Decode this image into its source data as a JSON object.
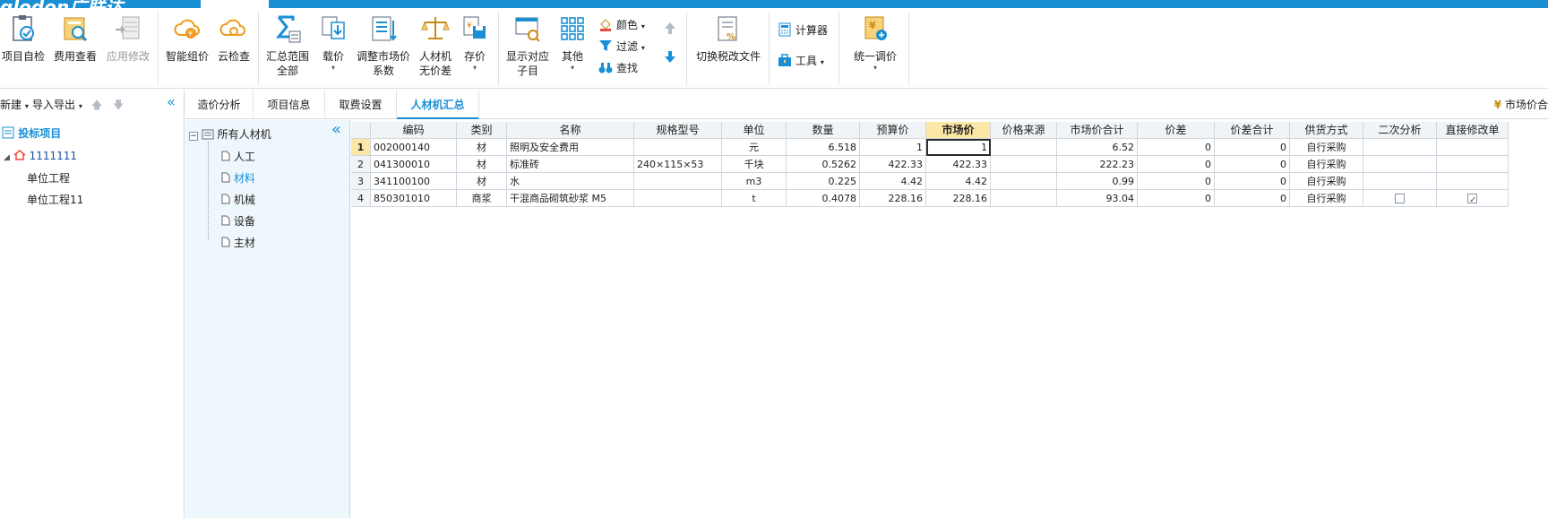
{
  "title_tabs": [
    "",
    ""
  ],
  "ribbon": {
    "items": [
      {
        "label1": "项目自检",
        "label2": ""
      },
      {
        "label1": "费用查看",
        "label2": ""
      },
      {
        "label1": "应用修改",
        "label2": ""
      },
      {
        "label1": "智能组价",
        "label2": ""
      },
      {
        "label1": "云检查",
        "label2": ""
      },
      {
        "label1": "汇总范围",
        "label2": "全部"
      },
      {
        "label1": "载价",
        "label2": ""
      },
      {
        "label1": "调整市场价",
        "label2": "系数"
      },
      {
        "label1": "人材机",
        "label2": "无价差"
      },
      {
        "label1": "存价",
        "label2": ""
      },
      {
        "label1": "显示对应",
        "label2": "子目"
      },
      {
        "label1": "其他",
        "label2": ""
      },
      {
        "label1": "切换税改文件",
        "label2": ""
      },
      {
        "label1": "统一调价",
        "label2": ""
      }
    ],
    "small": {
      "color": "颜色",
      "filter": "过滤",
      "find": "查找",
      "calculator": "计算器",
      "tools": "工具"
    }
  },
  "left_panel": {
    "new": "新建",
    "import_export": "导入导出",
    "root": "投标项目",
    "project": "1111111",
    "units": [
      "单位工程",
      "单位工程11"
    ]
  },
  "tabs": [
    "造价分析",
    "项目信息",
    "取费设置",
    "人材机汇总"
  ],
  "active_tab": "人材机汇总",
  "right_label": "市场价合",
  "category_tree": {
    "root": "所有人材机",
    "items": [
      "人工",
      "材料",
      "机械",
      "设备",
      "主材"
    ],
    "selected": "材料"
  },
  "grid": {
    "columns": [
      "编码",
      "类别",
      "名称",
      "规格型号",
      "单位",
      "数量",
      "预算价",
      "市场价",
      "价格来源",
      "市场价合计",
      "价差",
      "价差合计",
      "供货方式",
      "二次分析",
      "直接修改单"
    ],
    "active_column": "市场价",
    "rows": [
      {
        "n": "1",
        "code": "002000140",
        "type": "材",
        "name": "照明及安全费用",
        "spec": "",
        "unit": "元",
        "qty": "6.518",
        "budget": "1",
        "market": "1",
        "source": "",
        "total": "6.52",
        "diff": "0",
        "diff_total": "0",
        "supply": "自行采购",
        "second": null,
        "direct": null
      },
      {
        "n": "2",
        "code": "041300010",
        "type": "材",
        "name": "标准砖",
        "spec": "240×115×53",
        "unit": "千块",
        "qty": "0.5262",
        "budget": "422.33",
        "market": "422.33",
        "source": "",
        "total": "222.23",
        "diff": "0",
        "diff_total": "0",
        "supply": "自行采购",
        "second": null,
        "direct": null
      },
      {
        "n": "3",
        "code": "341100100",
        "type": "材",
        "name": "水",
        "spec": "",
        "unit": "m3",
        "qty": "0.225",
        "budget": "4.42",
        "market": "4.42",
        "source": "",
        "total": "0.99",
        "diff": "0",
        "diff_total": "0",
        "supply": "自行采购",
        "second": null,
        "direct": null
      },
      {
        "n": "4",
        "code": "850301010",
        "type": "商浆",
        "name": "干混商品砌筑砂浆 M5",
        "spec": "",
        "unit": "t",
        "qty": "0.4078",
        "budget": "228.16",
        "market": "228.16",
        "source": "",
        "total": "93.04",
        "diff": "0",
        "diff_total": "0",
        "supply": "自行采购",
        "second": false,
        "direct": true
      }
    ]
  },
  "colors": {
    "accent": "#1a8fd6",
    "active_header": "#fbe7a6",
    "tree_bg": "#eef7fc"
  }
}
